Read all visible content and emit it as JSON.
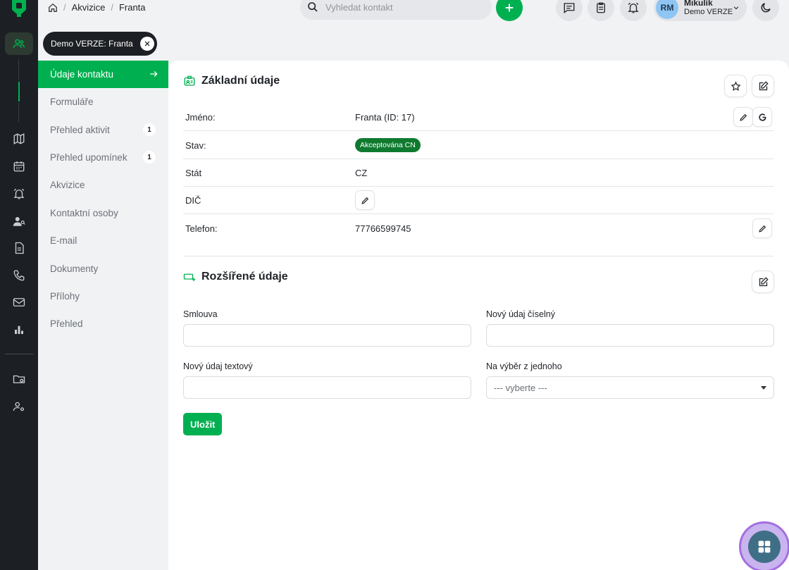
{
  "breadcrumb": {
    "items": [
      "Akvizice",
      "Franta"
    ]
  },
  "search": {
    "placeholder": "Vyhledat kontakt"
  },
  "user": {
    "initials": "RM",
    "name": "Mikulík",
    "org": "Demo VERZE"
  },
  "tab": {
    "label": "Demo VERZE: Franta"
  },
  "subnav": {
    "items": [
      {
        "label": "Údaje kontaktu",
        "badge": ""
      },
      {
        "label": "Formuláře",
        "badge": ""
      },
      {
        "label": "Přehled aktivit",
        "badge": "1"
      },
      {
        "label": "Přehled upomínek",
        "badge": "1"
      },
      {
        "label": "Akvizice",
        "badge": ""
      },
      {
        "label": "Kontaktní osoby",
        "badge": ""
      },
      {
        "label": "E-mail",
        "badge": ""
      },
      {
        "label": "Dokumenty",
        "badge": ""
      },
      {
        "label": "Přílohy",
        "badge": ""
      },
      {
        "label": "Přehled",
        "badge": ""
      }
    ]
  },
  "basic": {
    "title": "Základní údaje",
    "rows": [
      {
        "label": "Jméno:",
        "value": "Franta (ID: 17)"
      },
      {
        "label": "Stav:",
        "value": "Akceptována CN"
      },
      {
        "label": "Stát",
        "value": "CZ"
      },
      {
        "label": "DIČ",
        "value": ""
      },
      {
        "label": "Telefon:",
        "value": "77766599745"
      }
    ]
  },
  "extended": {
    "title": "Rozšířené údaje",
    "fields": {
      "smlouva_label": "Smlouva",
      "cislo_label": "Nový údaj číselný",
      "text_label": "Nový údaj textový",
      "vyber_label": "Na výběr z jednoho",
      "vyber_value": "--- vyberte ---"
    },
    "save_label": "Uložit"
  },
  "colors": {
    "accent": "#00b050",
    "rail": "#1c1f23",
    "badge_green": "#0f7a2f"
  }
}
